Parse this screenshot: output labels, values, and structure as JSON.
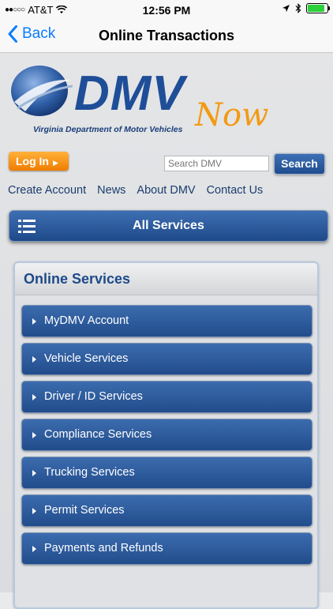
{
  "status_bar": {
    "carrier": "AT&T",
    "time": "12:56 PM"
  },
  "nav": {
    "back_label": "Back",
    "title": "Online Transactions"
  },
  "logo": {
    "brand": "DMV",
    "now": "Now",
    "subtitle": "Virginia Department of Motor Vehicles"
  },
  "header": {
    "login_label": "Log In",
    "search_placeholder": "Search DMV",
    "search_button": "Search"
  },
  "links": [
    "Create Account",
    "News",
    "About DMV",
    "Contact Us"
  ],
  "all_services": {
    "label": "All Services"
  },
  "panel": {
    "title": "Online Services",
    "items": [
      "MyDMV Account",
      "Vehicle Services",
      "Driver / ID Services",
      "Compliance Services",
      "Trucking Services",
      "Permit Services",
      "Payments and Refunds"
    ]
  },
  "colors": {
    "accent_blue": "#1f4e8f",
    "ios_blue": "#0a7cff",
    "orange": "#f07d00",
    "battery_green": "#2bd13b"
  }
}
